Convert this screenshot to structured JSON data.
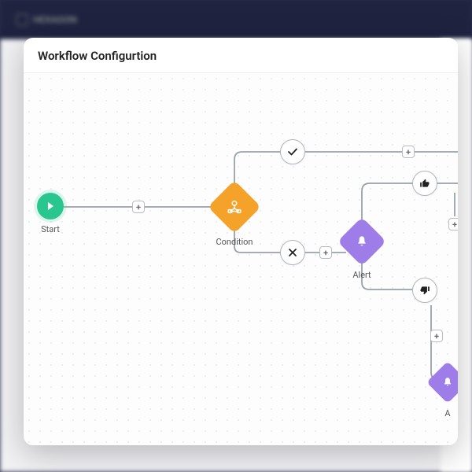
{
  "app": {
    "brand": "HEXAGON"
  },
  "modal": {
    "title": "Workflow Configurtion"
  },
  "nodes": {
    "start": {
      "label": "Start"
    },
    "condition": {
      "label": "Condition"
    },
    "alert": {
      "label": "Alert"
    },
    "alert2": {
      "label": "A"
    }
  }
}
